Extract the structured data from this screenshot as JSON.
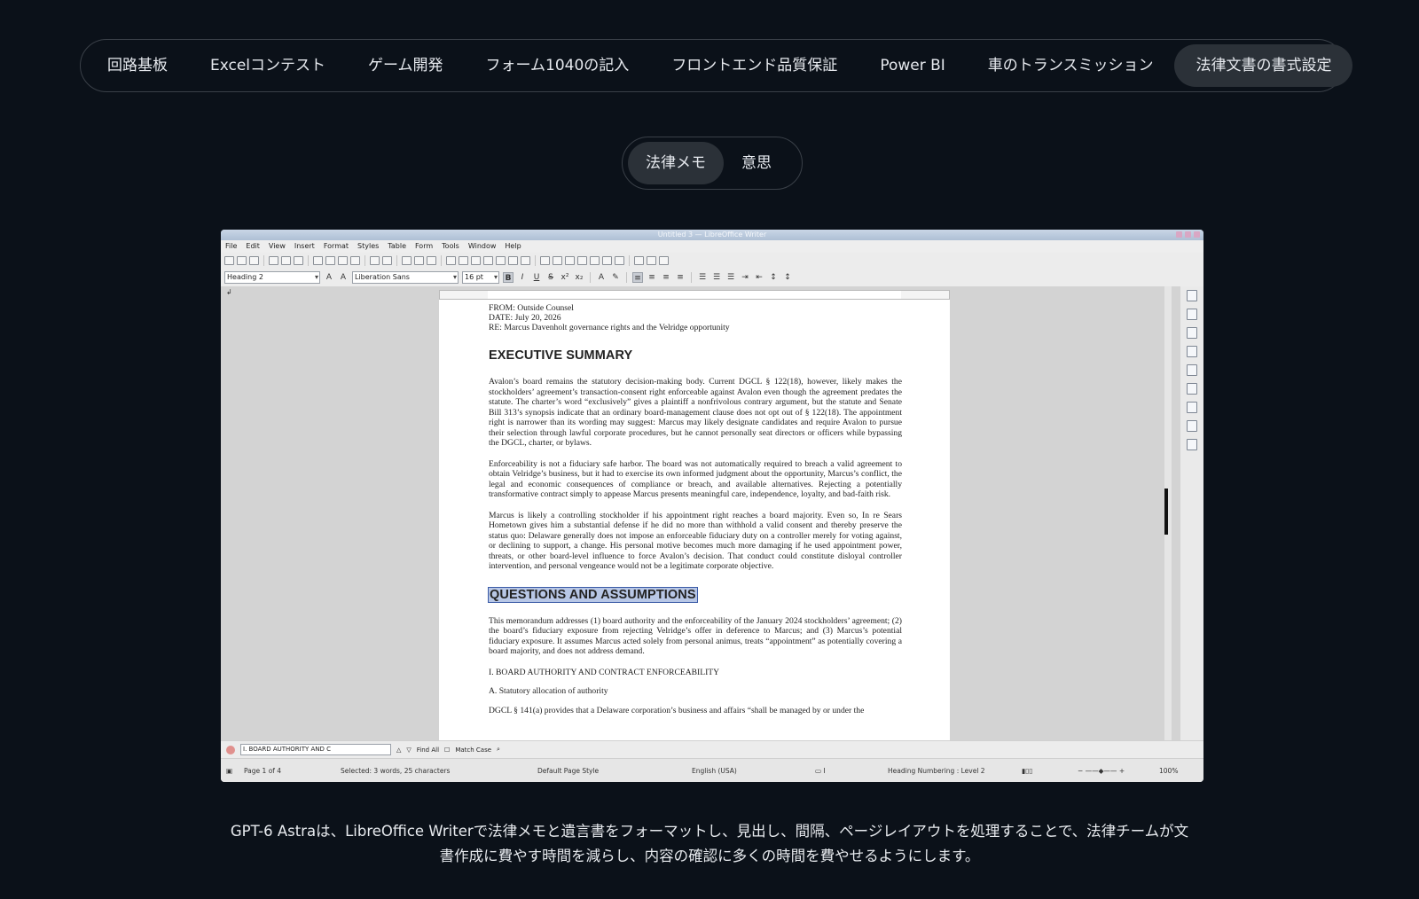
{
  "top_tabs": [
    {
      "label": "回路基板"
    },
    {
      "label": "Excelコンテスト"
    },
    {
      "label": "ゲーム開発"
    },
    {
      "label": "フォーム1040の記入"
    },
    {
      "label": "フロントエンド品質保証"
    },
    {
      "label": "Power BI"
    },
    {
      "label": "車のトランスミッション"
    },
    {
      "label": "法律文書の書式設定",
      "active": true
    }
  ],
  "sub_tabs": [
    {
      "label": "法律メモ",
      "active": true
    },
    {
      "label": "意思"
    }
  ],
  "writer": {
    "title": "Untitled 3 — LibreOffice Writer",
    "menu": [
      "File",
      "Edit",
      "View",
      "Insert",
      "Format",
      "Styles",
      "Table",
      "Form",
      "Tools",
      "Window",
      "Help"
    ],
    "paragraph_style": "Heading 2",
    "font_name": "Liberation Sans",
    "font_size": "16 pt",
    "document": {
      "memo_from": "FROM: Outside Counsel",
      "memo_date": "DATE: July 20, 2026",
      "memo_re": "RE: Marcus Davenholt governance rights and the Velridge opportunity",
      "heading_exec": "EXECUTIVE SUMMARY",
      "para1": "Avalon’s board remains the statutory decision-making body. Current DGCL § 122(18), however, likely makes the stockholders’ agreement’s transaction-consent right enforceable against Avalon even though the agreement predates the statute. The charter’s word “exclusively” gives a plaintiff a nonfrivolous contrary argument, but the statute and Senate Bill 313’s synopsis indicate that an ordinary board-management clause does not opt out of § 122(18). The appointment right is narrower than its wording may suggest: Marcus may likely designate candidates and require Avalon to pursue their selection through lawful corporate procedures, but he cannot personally seat directors or officers while bypassing the DGCL, charter, or bylaws.",
      "para2": "Enforceability is not a fiduciary safe harbor. The board was not automatically required to breach a valid agreement to obtain Velridge’s business, but it had to exercise its own informed judgment about the opportunity, Marcus’s conflict, the legal and economic consequences of compliance or breach, and available alternatives. Rejecting a potentially transformative contract simply to appease Marcus presents meaningful care, independence, loyalty, and bad-faith risk.",
      "para3": "Marcus is likely a controlling stockholder if his appointment right reaches a board majority. Even so, In re Sears Hometown gives him a substantial defense if he did no more than withhold a valid consent and thereby preserve the status quo: Delaware generally does not impose an enforceable fiduciary duty on a controller merely for voting against, or declining to support, a change. His personal motive becomes much more damaging if he used appointment power, threats, or other board-level influence to force Avalon’s decision. That conduct could constitute disloyal controller intervention, and personal vengeance would not be a legitimate corporate objective.",
      "heading_questions": "QUESTIONS AND ASSUMPTIONS",
      "para4": "This memorandum addresses (1) board authority and the enforceability of the January 2024 stockholders’ agreement; (2) the board’s fiduciary exposure from rejecting Velridge’s offer in deference to Marcus; and (3) Marcus’s potential fiduciary exposure. It assumes Marcus acted solely from personal animus, treats “appointment” as potentially covering a board majority, and does not address demand.",
      "section1": "I. BOARD AUTHORITY AND CONTRACT ENFORCEABILITY",
      "section1a": "A. Statutory allocation of authority",
      "para5": "DGCL § 141(a) provides that a Delaware corporation’s business and affairs “shall be managed by or under the"
    },
    "find_text": "I. BOARD AUTHORITY AND C",
    "find_all": "Find All",
    "match_case": "Match Case",
    "status": {
      "page": "Page 1 of 4",
      "selected": "Selected: 3 words, 25 characters",
      "page_style": "Default Page Style",
      "language": "English (USA)",
      "outline": "Heading Numbering : Level 2",
      "zoom": "100%"
    }
  },
  "caption_line1": "GPT-6 Astraは、LibreOffice Writerで法律メモと遺言書をフォーマットし、見出し、間隔、ページレイアウトを処理することで、法律チームが文",
  "caption_line2": "書作成に費やす時間を減らし、内容の確認に多くの時間を費やせるようにします。"
}
